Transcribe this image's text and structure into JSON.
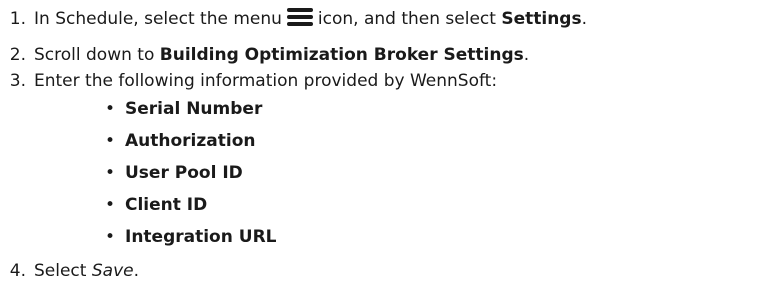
{
  "steps": {
    "s1": {
      "number": "1.",
      "text_before_icon": "In Schedule, select the menu",
      "icon": "hamburger-menu-icon",
      "text_after_icon": "icon, and then select",
      "bold": "Settings",
      "end": "."
    },
    "s2": {
      "number": "2.",
      "text": "Scroll down to",
      "bold": "Building Optimization Broker Settings",
      "end": "."
    },
    "s3": {
      "number": "3.",
      "text": "Enter the following information provided by WennSoft:",
      "fields": [
        "Serial Number",
        "Authorization",
        "User Pool ID",
        "Client ID",
        "Integration URL"
      ]
    },
    "s4": {
      "number": "4.",
      "text": "Select",
      "italic": "Save",
      "end": "."
    }
  },
  "bullet_char": "•"
}
